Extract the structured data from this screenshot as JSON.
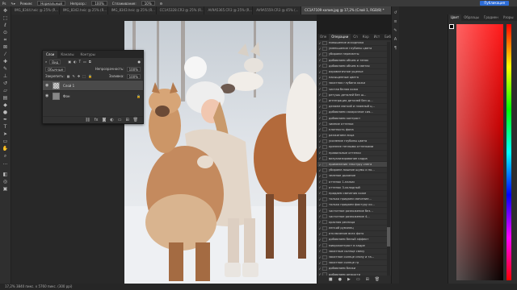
{
  "options_bar": {
    "mode_label": "Режим:",
    "mode_value": "Нормальный",
    "opacity_label": "Непрозр.:",
    "opacity_value": "100%",
    "smoothing_label": "Сглаживание:",
    "smoothing_value": "10%",
    "share_label": "Публикация"
  },
  "doc_tabs": [
    {
      "label": "IMG_8344.heic @ 25% (R...",
      "active": false
    },
    {
      "label": "IMG_8342.heic @ 25% (R...",
      "active": false
    },
    {
      "label": "IMG_8343.heic @ 25% (R...",
      "active": false
    },
    {
      "label": "CC1A5328.CR3 @ 25% (R...",
      "active": false
    },
    {
      "label": "AV9A5365.CR3 @ 25% (R...",
      "active": false
    },
    {
      "label": "AV9A5559.CR3 @ 45% (...",
      "active": false
    },
    {
      "label": "CC1A7109 копия.jpg @ 17,2% (Слой 1, RGB/8) *",
      "active": true
    }
  ],
  "layers_panel": {
    "tabs": [
      "Слои",
      "Каналы",
      "Контуры"
    ],
    "active_tab": "Слои",
    "filter_label": "Вид",
    "blend_mode": "Обычные",
    "opacity_label": "Непрозрачность:",
    "opacity_value": "100%",
    "lock_label": "Закрепить:",
    "fill_label": "Заливка:",
    "fill_value": "100%",
    "layers": [
      {
        "name": "Слой 1",
        "selected": true
      },
      {
        "name": "Фон",
        "selected": false,
        "locked": true
      }
    ]
  },
  "ops_panel": {
    "tabs": [
      "Опе",
      "Операции",
      "Сп",
      "Кор",
      "Ист",
      "Биб"
    ],
    "active_tab": "Операции",
    "highlight_index": 21,
    "items": [
      "повышение исходника",
      "уменьшение глубины цвета",
      "убираем пересветы",
      "добавляем объем и тенях",
      "добавляем объем в светах",
      "ахроматичное ущелье",
      "насыщенные цвета",
      "закатная глубина кожи",
      "чистая белая кожа",
      "ретушь деталей без ш...",
      "интеграция деталей без ш...",
      "делаем мягкий и плавный ц...",
      "добавляем сахарочное сия...",
      "добавляем контраст",
      "зимние оттенки",
      "плотность фона",
      "разжигаем лица",
      "усиление глубины цвета",
      "крепнее теплыми оттенками",
      "правильные оттенки",
      "визуализирование кадра",
      "применение текстуру снега",
      "убираем лишние шумы и по...",
      "зеленое дыхание",
      "оттенок 1-пальм",
      "оттенок 3-холодный",
      "придаем свечения коже",
      "только придаем свечение...",
      "только придаем фактуру ко...",
      "частотное разложение без...",
      "частотное разложение 4...",
      "красная ресница",
      "легкий румянец",
      "отключение всех фото",
      "добавляем белый эффект",
      "микроконтраст в кадре",
      "закатные солнце свеху",
      "закатное солнце снизу и та...",
      "закатное солнце гр",
      "добавляем блики",
      "добавляем резкости",
      "сохранение веб версии",
      "БОЛЬШИЕ РАМЫ ЗАЩИ..."
    ]
  },
  "color_panel": {
    "tabs": [
      "Цвет",
      "Образцы",
      "Градиен",
      "Узоры"
    ],
    "active_tab": "Цвет"
  },
  "status_bar": {
    "text": "17,2%  3840 пикс. x 5760 пикс. (300 ppi)"
  }
}
